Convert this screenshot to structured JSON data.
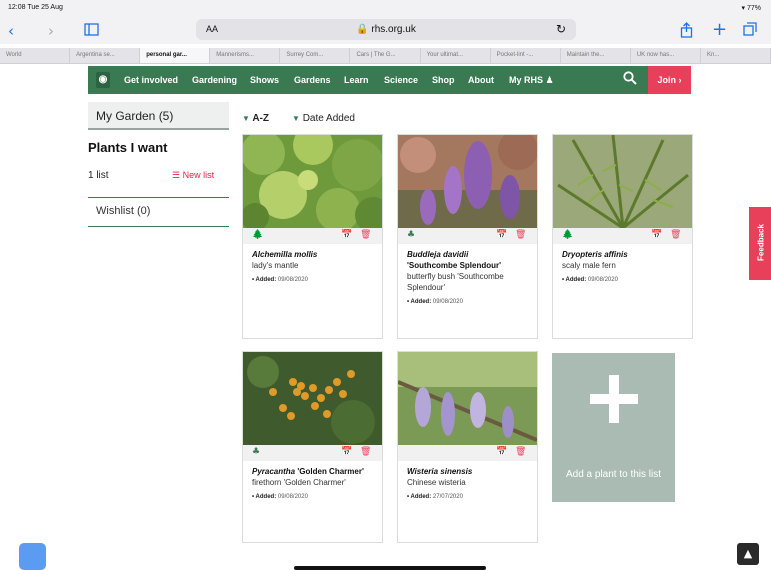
{
  "status_bar": {
    "time": "12:08  Tue 25 Aug",
    "battery": "▾ 77%"
  },
  "browser": {
    "text_size": "AA",
    "url": "🔒 rhs.org.uk",
    "reload_icon": "↻",
    "tabs": [
      "World",
      "Argentina se...",
      "personal gar...",
      "Mannerisms...",
      "Surrey Com...",
      "Cars | The G...",
      "Your ultimat...",
      "Pocket-lint -...",
      "Maintain the...",
      "UK now has...",
      "Kn..."
    ],
    "active_tab_index": 2
  },
  "nav": {
    "items": [
      "Get involved",
      "Gardening",
      "Shows",
      "Gardens",
      "Learn",
      "Science",
      "Shop",
      "About",
      "My RHS"
    ],
    "join": "Join ›",
    "color": "#3a7a52",
    "join_color": "#e83f5a"
  },
  "sidebar": {
    "my_garden": "My Garden (5)",
    "plants_title": "Plants I want",
    "list_count": "1 list",
    "new_list": "☰ New list",
    "wishlist": "Wishlist (0)"
  },
  "sort": {
    "az": "A-Z",
    "date": "Date Added",
    "arrow": "▼"
  },
  "plants": [
    {
      "latin": "Alchemilla mollis",
      "cultivar": "",
      "common": "lady's mantle",
      "added_label": "• Added:",
      "added": "09/08/2020"
    },
    {
      "latin": "Buddleja davidii",
      "cultivar": "'Southcombe Splendour'",
      "common": "butterfly bush 'Southcombe Splendour'",
      "added_label": "• Added:",
      "added": "09/08/2020"
    },
    {
      "latin": "Dryopteris affinis",
      "cultivar": "",
      "common": "scaly male fern",
      "added_label": "• Added:",
      "added": "09/08/2020"
    },
    {
      "latin": "Pyracantha",
      "cultivar": "'Golden Charmer'",
      "common": "firethorn 'Golden Charmer'",
      "added_label": "• Added:",
      "added": "09/08/2020"
    },
    {
      "latin": "Wisteria sinensis",
      "cultivar": "",
      "common": "Chinese wisteria",
      "added_label": "• Added:",
      "added": "27/07/2020"
    }
  ],
  "add_plant": "Add a plant to this list",
  "feedback": "Feedback",
  "to_top": "▲"
}
